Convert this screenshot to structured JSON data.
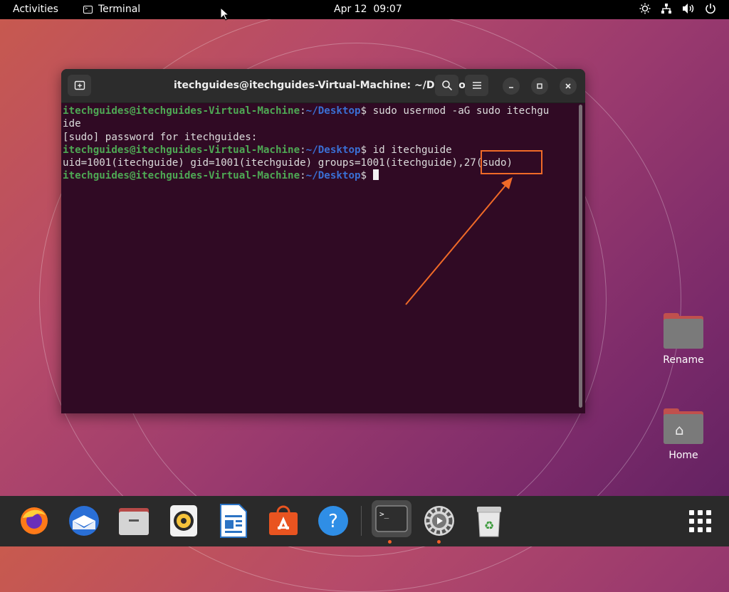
{
  "topbar": {
    "activities": "Activities",
    "app_name": "Terminal",
    "date": "Apr 12",
    "time": "09:07",
    "tray_icons": [
      "brightness-icon",
      "network-icon",
      "volume-icon",
      "power-icon"
    ]
  },
  "window": {
    "title": "itechguides@itechguides-Virtual-Machine: ~/Desktop",
    "new_tab_icon": "new-tab-icon",
    "buttons": [
      "search-icon",
      "menu-icon",
      "minimize-icon",
      "maximize-icon",
      "close-icon"
    ]
  },
  "terminal": {
    "prompt_user": "itechguides@itechguides-Virtual-Machine",
    "prompt_sep": ":",
    "prompt_path": "~/Desktop",
    "prompt_dollar": "$",
    "cmd1": " sudo usermod -aG sudo itechgu",
    "cmd1_wrap": "ide",
    "sudo_prompt": "[sudo] password for itechguides:",
    "cmd2": " id itechguide",
    "output": "uid=1001(itechguide) gid=1001(itechguide) groups=1001(itechguide),27(sudo)"
  },
  "annotation": {
    "color": "#f06a28"
  },
  "desktop": {
    "icons": [
      {
        "label": "Rename"
      },
      {
        "label": "Home"
      }
    ]
  },
  "dock": {
    "items": [
      "firefox-icon",
      "thunderbird-icon",
      "files-icon",
      "rhythmbox-icon",
      "writer-icon",
      "app-center-icon",
      "help-icon",
      "terminal-icon",
      "settings-icon",
      "trash-icon"
    ],
    "show_apps": "show-apps-icon"
  },
  "colors": {
    "terminal_bg": "#300a24",
    "prompt_user": "#4ea854",
    "prompt_path": "#3a6fd4",
    "accent": "#f0602a"
  }
}
